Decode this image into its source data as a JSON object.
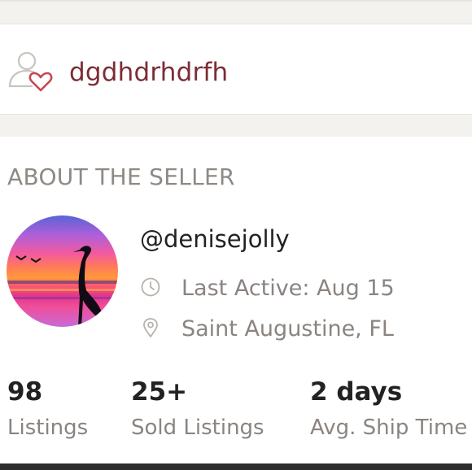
{
  "likes": {
    "icon": "user-heart-icon",
    "text": "dgdhdrhdrfh"
  },
  "section_title": "ABOUT THE SELLER",
  "seller": {
    "avatar": "heron-sunset-avatar",
    "username": "@denisejolly",
    "last_active": "Last Active: Aug 15",
    "last_active_icon": "clock-icon",
    "location": "Saint Augustine, FL",
    "location_icon": "location-pin-icon"
  },
  "stats": [
    {
      "value": "98",
      "label": "Listings"
    },
    {
      "value": "25+",
      "label": "Sold Listings"
    },
    {
      "value": "2 days",
      "label": "Avg. Ship Time"
    }
  ],
  "colors": {
    "likes_text": "#7d2c36",
    "heart": "#c7474f",
    "muted_text": "#8a8480",
    "primary_text": "#222222",
    "strip_background": "#f4f2ee"
  }
}
